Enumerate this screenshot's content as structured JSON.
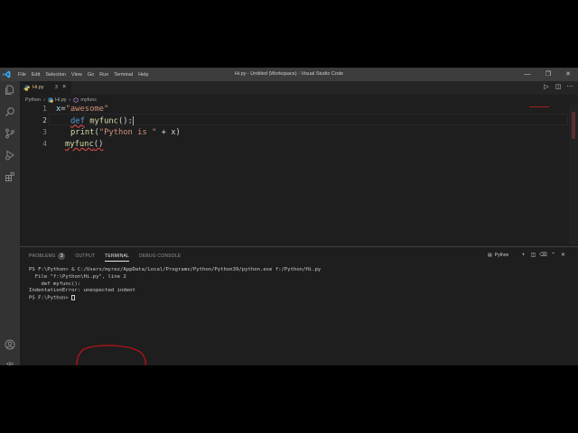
{
  "window": {
    "title": "Hi.py - Untitled (Workspace) - Visual Studio Code"
  },
  "menu": [
    "File",
    "Edit",
    "Selection",
    "View",
    "Go",
    "Run",
    "Terminal",
    "Help"
  ],
  "activity_bar": [
    "explorer-icon",
    "search-icon",
    "source-control-icon",
    "run-debug-icon",
    "extensions-icon",
    "account-icon",
    "gear-icon"
  ],
  "tab": {
    "label": "Hi.py",
    "problems": "3",
    "close": "×"
  },
  "breadcrumb": [
    "Python",
    "Hi.py",
    "myfunc"
  ],
  "editor": {
    "line_numbers": [
      "1",
      "2",
      "3",
      "4"
    ],
    "lines": [
      [
        "x",
        "=",
        "\"awesome\""
      ],
      [
        "def",
        "myfunc",
        "():"
      ],
      [
        "print",
        "(",
        "\"Python is \"",
        " + x)"
      ],
      [
        "myfunc",
        "()"
      ]
    ]
  },
  "panel": {
    "tabs": [
      "PROBLEMS",
      "OUTPUT",
      "TERMINAL",
      "DEBUG CONSOLE"
    ],
    "problems_count": "3",
    "terminal_selector": "Python",
    "terminal_lines": [
      "PS F:\\Python> & C:/Users/myrez/AppData/Local/Programs/Python/Python39/python.exe f:/Python/Hi.py",
      "  File \"f:\\Python\\Hi.py\", line 2",
      "    def myfunc():",
      "IndentationError: unexpected indent",
      "PS F:\\Python> "
    ]
  },
  "colors": {
    "keyword": "#569cd6",
    "function": "#dcdcaa",
    "string": "#ce9178",
    "variable": "#9cdcfe",
    "error": "#f14c4c",
    "annotation": "#c0101a"
  }
}
